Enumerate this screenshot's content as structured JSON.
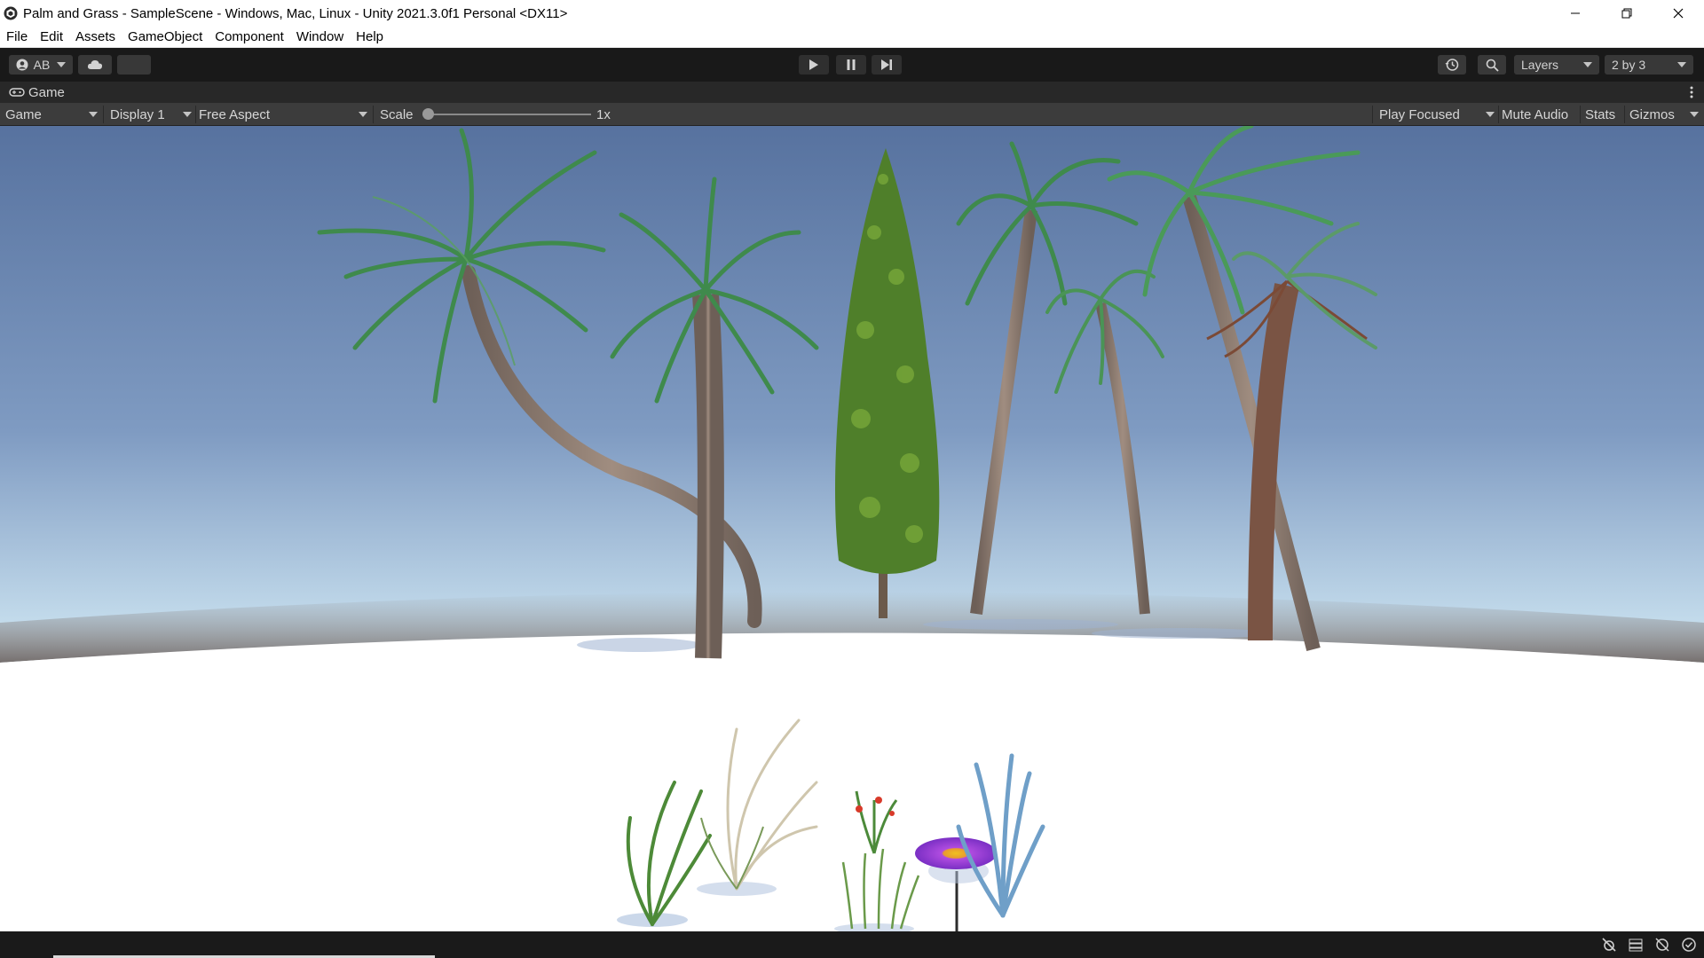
{
  "window": {
    "title": "Palm and Grass - SampleScene - Windows, Mac, Linux - Unity 2021.3.0f1 Personal <DX11>"
  },
  "menu": [
    "File",
    "Edit",
    "Assets",
    "GameObject",
    "Component",
    "Window",
    "Help"
  ],
  "toolbar": {
    "account_label": "AB",
    "layers_label": "Layers",
    "layout_label": "2 by 3"
  },
  "tab": {
    "label": "Game"
  },
  "game_bar": {
    "mode_label": "Game",
    "display_label": "Display 1",
    "aspect_label": "Free Aspect",
    "scale_label": "Scale",
    "scale_value": "1x",
    "scale_level": 0.0,
    "play_focused_label": "Play Focused",
    "mute_audio_label": "Mute Audio",
    "stats_label": "Stats",
    "gizmos_label": "Gizmos"
  },
  "colors": {
    "sky_top": "#5b79a8",
    "sky_horizon": "#eaf4fb",
    "ground": "#ffffff",
    "palm_leaf": "#3f8a4c",
    "trunk": "#8f7a6b",
    "cypress": "#4f7f2a",
    "flower": "#8a3fd6"
  },
  "icons": {
    "app": "unity-logo-icon",
    "account": "account-icon",
    "cloud": "cloud-icon",
    "play": "play-icon",
    "pause": "pause-icon",
    "step": "step-icon",
    "history": "history-icon",
    "search": "search-icon"
  }
}
